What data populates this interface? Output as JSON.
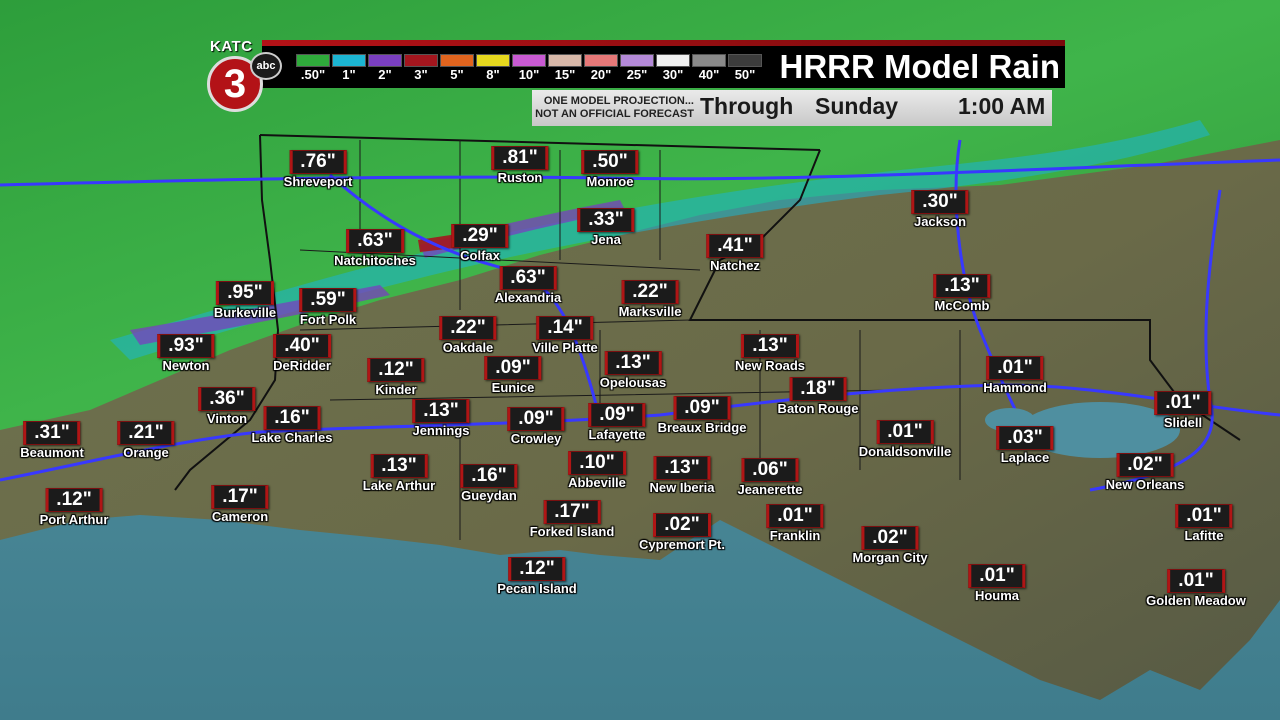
{
  "header": {
    "logo_text": "KATC",
    "logo_number": "3",
    "network": "abc",
    "title": "HRRR Model Rain",
    "disclaimer_line1": "ONE MODEL PROJECTION...",
    "disclaimer_line2": "NOT AN OFFICIAL FORECAST",
    "through": "Through",
    "day": "Sunday",
    "time": "1:00 AM"
  },
  "colors": {
    "brand_red": "#b31217",
    "water": "#4f8fa0",
    "land": "#6b6f4a"
  },
  "scale": [
    {
      "label": ".50\"",
      "color": "#2faa3b"
    },
    {
      "label": "1\"",
      "color": "#1cb5d2"
    },
    {
      "label": "2\"",
      "color": "#7a3fc0"
    },
    {
      "label": "3\"",
      "color": "#a3161e"
    },
    {
      "label": "5\"",
      "color": "#e0641e"
    },
    {
      "label": "8\"",
      "color": "#e6d81e"
    },
    {
      "label": "10\"",
      "color": "#c85ad2"
    },
    {
      "label": "15\"",
      "color": "#d8b8a8"
    },
    {
      "label": "20\"",
      "color": "#e67878"
    },
    {
      "label": "25\"",
      "color": "#b48ad8"
    },
    {
      "label": "30\"",
      "color": "#f0f0f0"
    },
    {
      "label": "40\"",
      "color": "#8a8a8a"
    },
    {
      "label": "50\"",
      "color": "#3c3c3c"
    }
  ],
  "stations": [
    {
      "name": "Shreveport",
      "value": ".76\""
    },
    {
      "name": "Ruston",
      "value": ".81\""
    },
    {
      "name": "Monroe",
      "value": ".50\""
    },
    {
      "name": "Jackson",
      "value": ".30\""
    },
    {
      "name": "Natchitoches",
      "value": ".63\""
    },
    {
      "name": "Colfax",
      "value": ".29\""
    },
    {
      "name": "Jena",
      "value": ".33\""
    },
    {
      "name": "Natchez",
      "value": ".41\""
    },
    {
      "name": "Alexandria",
      "value": ".63\""
    },
    {
      "name": "McComb",
      "value": ".13\""
    },
    {
      "name": "Burkeville",
      "value": ".95\""
    },
    {
      "name": "Fort Polk",
      "value": ".59\""
    },
    {
      "name": "Marksville",
      "value": ".22\""
    },
    {
      "name": "Oakdale",
      "value": ".22\""
    },
    {
      "name": "Ville Platte",
      "value": ".14\""
    },
    {
      "name": "Newton",
      "value": ".93\""
    },
    {
      "name": "DeRidder",
      "value": ".40\""
    },
    {
      "name": "New Roads",
      "value": ".13\""
    },
    {
      "name": "Kinder",
      "value": ".12\""
    },
    {
      "name": "Eunice",
      "value": ".09\""
    },
    {
      "name": "Opelousas",
      "value": ".13\""
    },
    {
      "name": "Hammond",
      "value": ".01\""
    },
    {
      "name": "Vinton",
      "value": ".36\""
    },
    {
      "name": "Baton Rouge",
      "value": ".18\""
    },
    {
      "name": "Jennings",
      "value": ".13\""
    },
    {
      "name": "Breaux Bridge",
      "value": ".09\""
    },
    {
      "name": "Slidell",
      "value": ".01\""
    },
    {
      "name": "Lake Charles",
      "value": ".16\""
    },
    {
      "name": "Crowley",
      "value": ".09\""
    },
    {
      "name": "Lafayette",
      "value": ".09\""
    },
    {
      "name": "Beaumont",
      "value": ".31\""
    },
    {
      "name": "Orange",
      "value": ".21\""
    },
    {
      "name": "Donaldsonville",
      "value": ".01\""
    },
    {
      "name": "Laplace",
      "value": ".03\""
    },
    {
      "name": "Lake Arthur",
      "value": ".13\""
    },
    {
      "name": "Abbeville",
      "value": ".10\""
    },
    {
      "name": "New Iberia",
      "value": ".13\""
    },
    {
      "name": "Jeanerette",
      "value": ".06\""
    },
    {
      "name": "Gueydan",
      "value": ".16\""
    },
    {
      "name": "New Orleans",
      "value": ".02\""
    },
    {
      "name": "Port Arthur",
      "value": ".12\""
    },
    {
      "name": "Cameron",
      "value": ".17\""
    },
    {
      "name": "Forked Island",
      "value": ".17\""
    },
    {
      "name": "Franklin",
      "value": ".01\""
    },
    {
      "name": "Lafitte",
      "value": ".01\""
    },
    {
      "name": "Cypremort Pt.",
      "value": ".02\""
    },
    {
      "name": "Morgan City",
      "value": ".02\""
    },
    {
      "name": "Pecan Island",
      "value": ".12\""
    },
    {
      "name": "Houma",
      "value": ".01\""
    },
    {
      "name": "Golden Meadow",
      "value": ".01\""
    }
  ]
}
